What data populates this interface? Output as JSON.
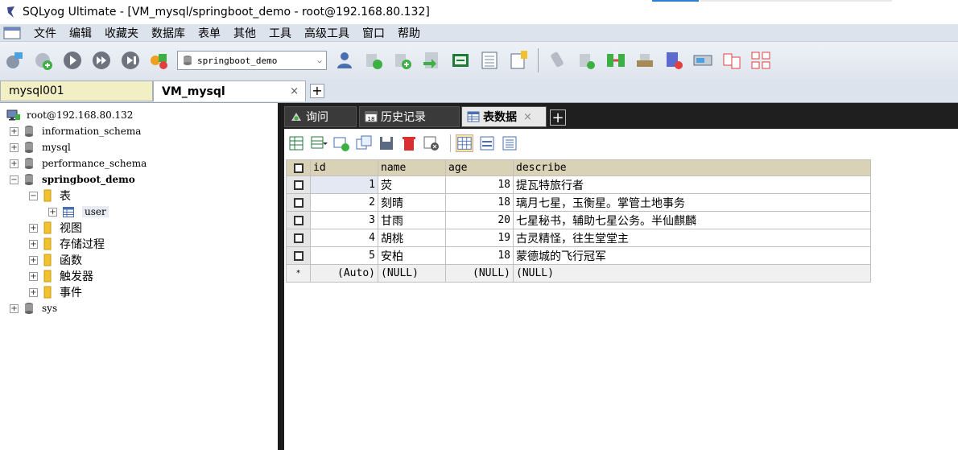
{
  "window": {
    "title": "SQLyog Ultimate - [VM_mysql/springboot_demo - root@192.168.80.132]"
  },
  "menu": [
    "文件",
    "编辑",
    "收藏夹",
    "数据库",
    "表单",
    "其他",
    "工具",
    "高级工具",
    "窗口",
    "帮助"
  ],
  "toolbar": {
    "database_selected": "springboot_demo"
  },
  "connection_tabs": [
    {
      "label": "mysql001",
      "active": false
    },
    {
      "label": "VM_mysql",
      "active": true,
      "close": "×"
    }
  ],
  "add_tab_symbol": "+",
  "tree": {
    "root": "root@192.168.80.132",
    "expander_closed": "+",
    "expander_open": "−",
    "databases": [
      {
        "name": "information_schema"
      },
      {
        "name": "mysql"
      },
      {
        "name": "performance_schema"
      },
      {
        "name": "springboot_demo"
      },
      {
        "name": "sys"
      }
    ],
    "springboot_demo_children": {
      "tables_folder": "表",
      "table": "user",
      "views": "视图",
      "procedures": "存储过程",
      "functions": "函数",
      "triggers": "触发器",
      "events": "事件"
    }
  },
  "query_tabs": [
    {
      "label": "询问"
    },
    {
      "label": "历史记录"
    },
    {
      "label": "表数据",
      "active": true,
      "close": "×"
    }
  ],
  "grid": {
    "columns": [
      "id",
      "name",
      "age",
      "describe"
    ],
    "rows": [
      {
        "id": "1",
        "name": "荧",
        "age": "18",
        "describe": "提瓦特旅行者"
      },
      {
        "id": "2",
        "name": "刻晴",
        "age": "18",
        "describe": "璃月七星，玉衡星。掌管土地事务"
      },
      {
        "id": "3",
        "name": "甘雨",
        "age": "20",
        "describe": "七星秘书，辅助七星公务。半仙麒麟"
      },
      {
        "id": "4",
        "name": "胡桃",
        "age": "19",
        "describe": "古灵精怪，往生堂堂主"
      },
      {
        "id": "5",
        "name": "安柏",
        "age": "18",
        "describe": "蒙德城的飞行冠军"
      }
    ],
    "new_row": {
      "marker": "*",
      "id": "(Auto)",
      "name": "(NULL)",
      "age": "(NULL)",
      "describe": "(NULL)"
    }
  }
}
